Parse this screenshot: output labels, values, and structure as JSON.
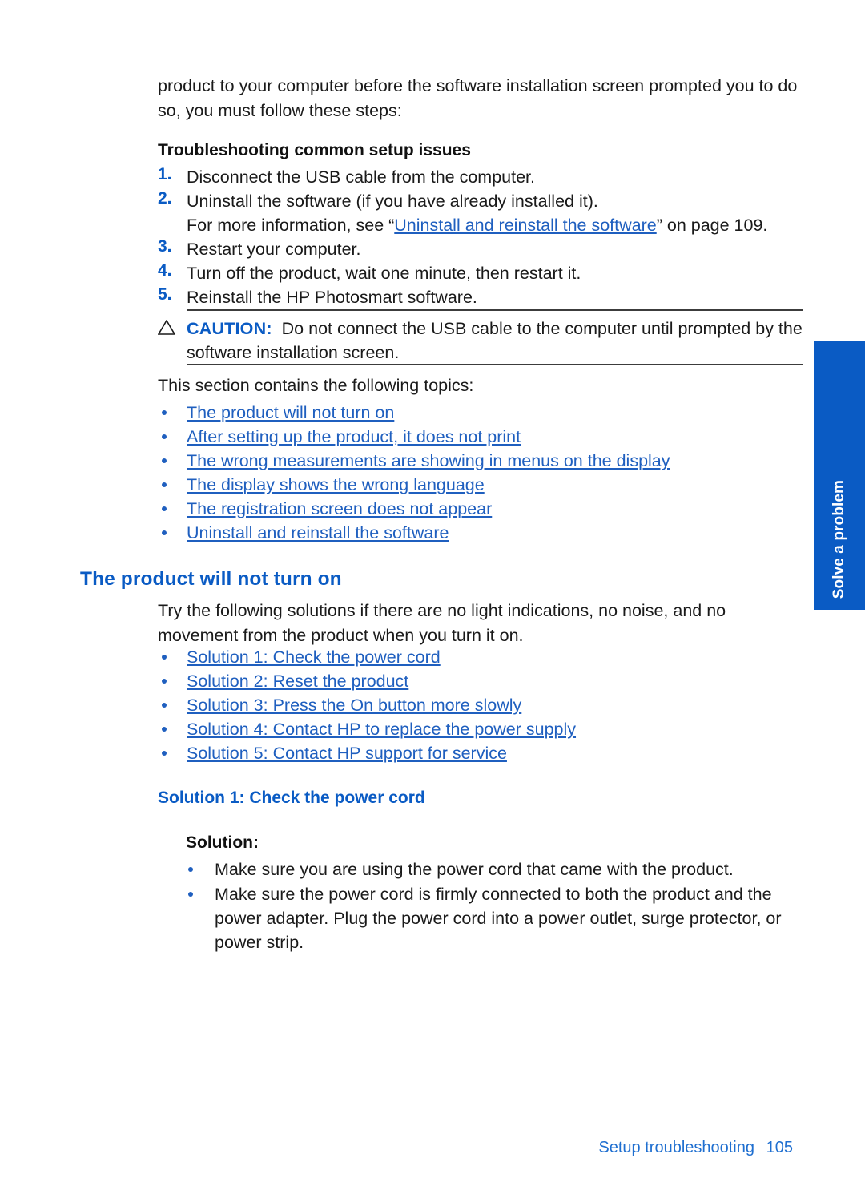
{
  "page": {
    "intro_paragraph": "product to your computer before the software installation screen prompted you to do so, you must follow these steps:",
    "troubleshooting_heading": "Troubleshooting common setup issues",
    "section_intro": "This section contains the following topics:",
    "product_heading": "The product will not turn on",
    "try_paragraph": "Try the following solutions if there are no light indications, no noise, and no movement from the product when you turn it on.",
    "solution1_heading": "Solution 1: Check the power cord",
    "solution_label": "Solution:"
  },
  "steps": [
    {
      "num": "1.",
      "text": "Disconnect the USB cable from the computer."
    },
    {
      "num": "2.",
      "text": "Uninstall the software (if you have already installed it)."
    },
    {
      "num": "3.",
      "text": "Restart your computer."
    },
    {
      "num": "4.",
      "text": "Turn off the product, wait one minute, then restart it."
    },
    {
      "num": "5.",
      "text": "Reinstall the HP Photosmart software."
    }
  ],
  "step2_note": {
    "prefix": "For more information, see “",
    "link": "Uninstall and reinstall the software",
    "suffix": "” on page 109."
  },
  "caution": {
    "icon": "warning-triangle-icon",
    "label": "CAUTION:",
    "text": "Do not connect the USB cable to the computer until prompted by the software installation screen."
  },
  "topics": [
    "The product will not turn on",
    "After setting up the product, it does not print",
    "The wrong measurements are showing in menus on the display",
    "The display shows the wrong language",
    "The registration screen does not appear",
    "Uninstall and reinstall the software"
  ],
  "solutions": [
    "Solution 1: Check the power cord",
    "Solution 2: Reset the product",
    "Solution 3: Press the On button more slowly",
    "Solution 4: Contact HP to replace the power supply",
    "Solution 5: Contact HP support for service"
  ],
  "solution_items": [
    "Make sure you are using the power cord that came with the product.",
    "Make sure the power cord is firmly connected to both the product and the power adapter. Plug the power cord into a power outlet, surge protector, or power strip."
  ],
  "side_tab": {
    "label": "Solve a problem",
    "color": "#0a5bc4"
  },
  "footer": {
    "title": "Setup troubleshooting",
    "page_number": "105"
  },
  "colors": {
    "heading_blue": "#0a5bc4",
    "link_blue": "#1f5fbf",
    "footer_blue": "#1f6fd0",
    "body_black": "#1a1a1a"
  }
}
